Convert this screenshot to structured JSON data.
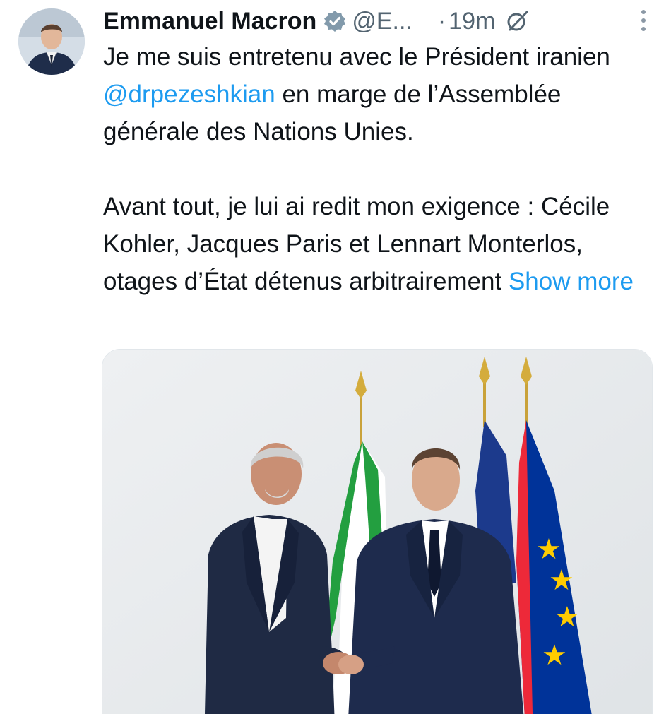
{
  "author": {
    "name": "Emmanuel Macron",
    "handle": "@E...",
    "separator": "·",
    "time": "19m"
  },
  "tweet": {
    "line1": "Je me suis entretenu avec le Président iranien ",
    "mention": "@drpezeshkian",
    "line1_end": " en marge de l’Assemblée générale des Nations Unies.",
    "paragraph2": "Avant tout, je lui ai redit mon exigence : Cécile Kohler, Jacques Paris et Lennart Monterlos, otages d’État détenus arbitrairement ",
    "show_more": "Show more"
  },
  "icons": {
    "verified": "verified-badge-icon",
    "grok": "grok-icon",
    "more": "more-options-icon"
  },
  "colors": {
    "link": "#1d9bf0",
    "secondary_text": "#536471",
    "verified": "#829aab"
  }
}
